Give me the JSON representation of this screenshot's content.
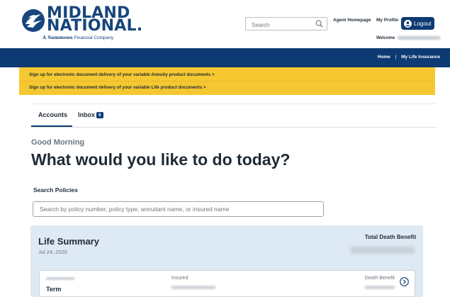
{
  "brand": {
    "name_line1": "MIDLAND",
    "name_line2": "NATIONAL",
    "tagline_bold": "A Sammons",
    "tagline_rest": "Financial Company"
  },
  "header": {
    "search_placeholder": "Search",
    "agent_homepage": "Agent Homepage",
    "my_profile": "My Profile",
    "logout": "Logout",
    "welcome": "Welcome"
  },
  "nav": {
    "home": "Home",
    "separator": "|",
    "my_life_insurance": "My Life Insurance"
  },
  "banner": {
    "annuity_msg": "Sign up for electronic document delivery of your variable Annuity product documents >",
    "life_msg": "Sign up for electronic document delivery of your variable Life product documents >"
  },
  "tabs": {
    "accounts": "Accounts",
    "inbox": "Inbox",
    "inbox_count": "5"
  },
  "main": {
    "greeting": "Good Morning",
    "headline": "What would you like to do today?",
    "search_policies_label": "Search Policies",
    "search_policies_placeholder": "Search by policy number, policy type, annuitant name, or insured name"
  },
  "summary": {
    "title": "Life Summary",
    "date": "Jul 24, 2020",
    "total_death_benefit_label": "Total Death Benefit"
  },
  "policy": {
    "type": "Term",
    "insured_label": "Insured",
    "death_benefit_label": "Death Benefit"
  },
  "colors": {
    "brand_navy": "#0e3a73",
    "banner_yellow": "#f5c832",
    "summary_bg": "#dde9f3"
  },
  "icons": {
    "logo": "eagle-logo-icon",
    "search": "search-icon",
    "user": "user-circle-icon",
    "chevron": "chevron-right-circle-icon"
  }
}
